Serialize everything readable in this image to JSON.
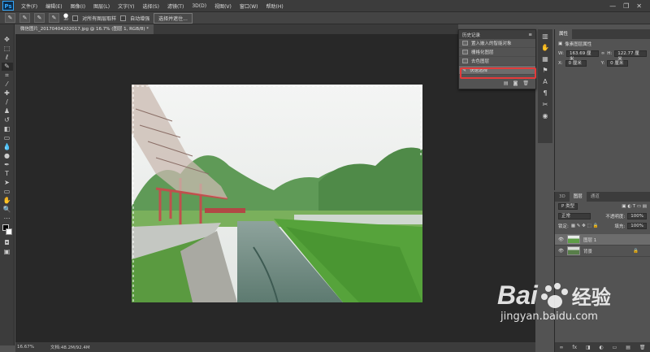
{
  "app": {
    "logo": "Ps"
  },
  "menu": [
    "文件(F)",
    "编辑(E)",
    "图像(I)",
    "图层(L)",
    "文字(Y)",
    "选择(S)",
    "滤镜(T)",
    "3D(D)",
    "视图(V)",
    "窗口(W)",
    "帮助(H)"
  ],
  "options": {
    "sample_all_layers": "对所有图层取样",
    "auto_enhance": "自动增强",
    "refine_button": "选择并遮住...",
    "brush_size": "30"
  },
  "document": {
    "tab_title": "微信图片_20170404202017.jpg @ 16.7% (图层 1, RGB/8) *",
    "zoom": "16.67%",
    "doc_size": "文档:48.2M/92.4M"
  },
  "history": {
    "title": "历史记录",
    "items": [
      "置入嵌入的智能对象",
      "栅格化图层",
      "去色图层",
      "快速选择"
    ]
  },
  "properties": {
    "tabs": [
      "属性"
    ],
    "type_label": "像素图层属性",
    "w_label": "W:",
    "w_value": "163.69 厘米",
    "link_icon": "link-icon",
    "h_label": "H:",
    "h_value": "122.77 厘米",
    "x_label": "X:",
    "x_value": "0 厘米",
    "y_label": "Y:",
    "y_value": "0 厘米"
  },
  "layers": {
    "tabs": [
      "3D",
      "图层",
      "通道"
    ],
    "kind": "P 类型",
    "blend_mode": "正常",
    "opacity_label": "不透明度:",
    "opacity_value": "100%",
    "lock_label": "锁定:",
    "fill_label": "填充:",
    "fill_value": "100%",
    "items": [
      "图层 1",
      "背景"
    ]
  },
  "watermark": {
    "brand": "Bai",
    "brand2": "经验",
    "url": "jingyan.baidu.com"
  },
  "colors": {
    "accent_red": "#e33b3b",
    "selection": "#6c6c6c"
  }
}
